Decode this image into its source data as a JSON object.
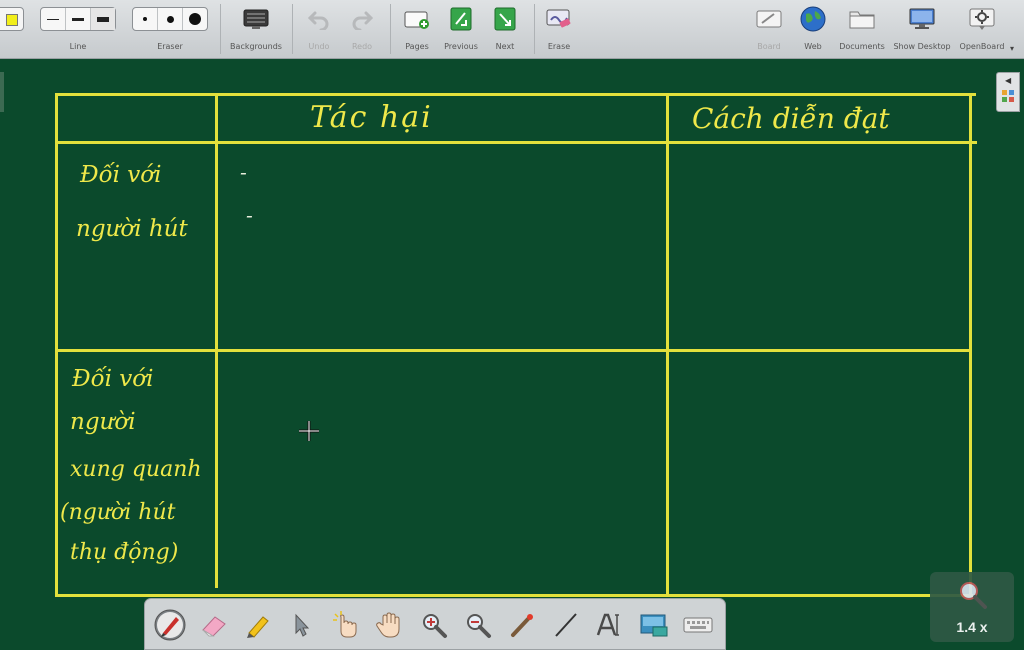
{
  "toolbar": {
    "line_label": "Line",
    "eraser_label": "Eraser",
    "backgrounds_label": "Backgrounds",
    "undo_label": "Undo",
    "redo_label": "Redo",
    "pages_label": "Pages",
    "previous_label": "Previous",
    "next_label": "Next",
    "erase_label": "Erase",
    "board_label": "Board",
    "web_label": "Web",
    "documents_label": "Documents",
    "show_desktop_label": "Show Desktop",
    "openboard_label": "OpenBoard"
  },
  "table": {
    "header_col2": "Tác hại",
    "header_col3": "Cách diễn đạt",
    "row1_label_line1": "Đối với",
    "row1_label_line2": "người hút",
    "row1_bullet1": "-",
    "row1_bullet2": "-",
    "row2_label_line1": "Đối với",
    "row2_label_line2": "người",
    "row2_label_line3": "xung quanh",
    "row2_label_line4": "(người hút",
    "row2_label_line5": "thụ động)"
  },
  "zoom": {
    "label": "1.4 x"
  },
  "colors": {
    "board": "#0b4a2c",
    "chalk": "#e3e03c",
    "toolbar": "#d4d7d9"
  },
  "dock_icons": [
    "pen-icon",
    "eraser-icon",
    "highlighter-icon",
    "pointer-icon",
    "interact-hand-icon",
    "pan-hand-icon",
    "zoom-in-icon",
    "zoom-out-icon",
    "laser-pointer-icon",
    "line-icon",
    "text-icon",
    "capture-icon",
    "keyboard-icon"
  ]
}
